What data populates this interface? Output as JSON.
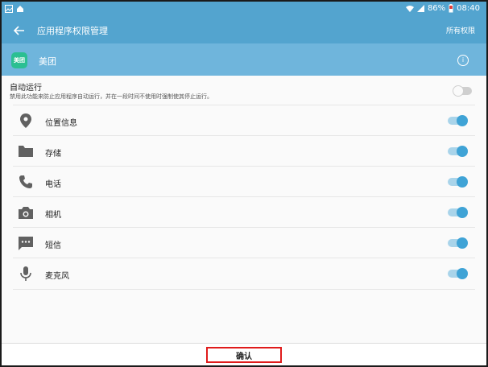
{
  "statusbar": {
    "battery": "86%",
    "time": "08:40"
  },
  "appbar": {
    "title": "应用程序权限管理",
    "all_permissions": "所有权限"
  },
  "app": {
    "icon_text": "美团",
    "name": "美团"
  },
  "autorun": {
    "title": "自动运行",
    "description": "禁用此功能来防止应用程序自动运行，并在一段时间不使用时强制使其停止运行。",
    "enabled": false
  },
  "permissions": [
    {
      "label": "位置信息",
      "icon": "location-icon",
      "enabled": true
    },
    {
      "label": "存储",
      "icon": "folder-icon",
      "enabled": true
    },
    {
      "label": "电话",
      "icon": "phone-icon",
      "enabled": true
    },
    {
      "label": "相机",
      "icon": "camera-icon",
      "enabled": true
    },
    {
      "label": "短信",
      "icon": "sms-icon",
      "enabled": true
    },
    {
      "label": "麦克风",
      "icon": "microphone-icon",
      "enabled": true
    }
  ],
  "footer": {
    "confirm_label": "确认"
  },
  "colors": {
    "header": "#53a4cf",
    "app_row": "#6fb5dc",
    "toggle_on": "#3fa3d6",
    "highlight": "#e01b1b"
  }
}
